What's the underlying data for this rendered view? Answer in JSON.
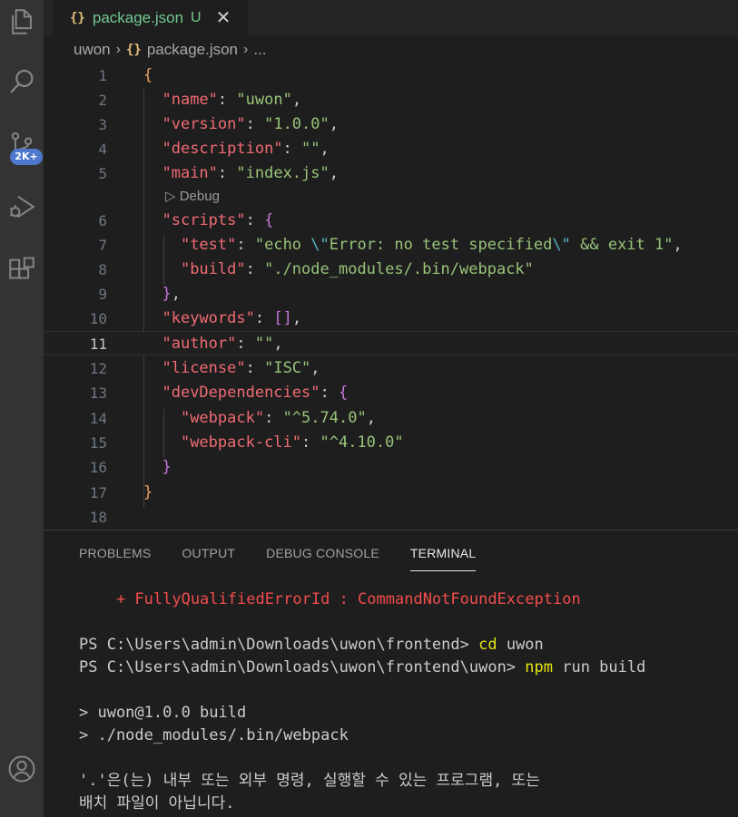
{
  "activity_bar": {
    "icons": [
      "explorer-icon",
      "search-icon",
      "source-control-icon",
      "run-debug-icon",
      "extensions-icon",
      "account-icon"
    ],
    "badge": "2K+"
  },
  "tab": {
    "icon": "{}",
    "name": "package.json",
    "status": "U",
    "close": "✕"
  },
  "breadcrumb": {
    "folder": "uwon",
    "file_icon": "{}",
    "file": "package.json",
    "sep": "›",
    "more": "..."
  },
  "editor": {
    "codelens": "Debug",
    "codelens_icon": "▷",
    "active_line": 11,
    "lines": [
      {
        "n": "1"
      },
      {
        "n": "2"
      },
      {
        "n": "3"
      },
      {
        "n": "4"
      },
      {
        "n": "5"
      },
      {
        "n": "6"
      },
      {
        "n": "7"
      },
      {
        "n": "8"
      },
      {
        "n": "9"
      },
      {
        "n": "10"
      },
      {
        "n": "11"
      },
      {
        "n": "12"
      },
      {
        "n": "13"
      },
      {
        "n": "14"
      },
      {
        "n": "15"
      },
      {
        "n": "16"
      },
      {
        "n": "17"
      },
      {
        "n": "18"
      }
    ]
  },
  "panel": {
    "tabs": [
      "PROBLEMS",
      "OUTPUT",
      "DEBUG CONSOLE",
      "TERMINAL"
    ],
    "active_tab": "TERMINAL",
    "terminal": {
      "error_line": "    + FullyQualifiedErrorId : CommandNotFoundException",
      "prompt1": "PS C:\\Users\\admin\\Downloads\\uwon\\frontend> ",
      "cmd1": "cd",
      "arg1": " uwon",
      "prompt2": "PS C:\\Users\\admin\\Downloads\\uwon\\frontend\\uwon> ",
      "cmd2": "npm",
      "arg2": " run build",
      "out1": "> uwon@1.0.0 build",
      "out2": "> ./node_modules/.bin/webpack",
      "msg1": "'.'은(는) 내부 또는 외부 명령, 실행할 수 있는 프로그램, 또는",
      "msg2": "배치 파일이 아닙니다."
    }
  },
  "colors": {
    "key": "#ef6b73",
    "string": "#98c379",
    "brace": "#e5a260",
    "bracket2": "#c678dd",
    "terminal_error": "#f14c4c",
    "terminal_cmd": "#e5e510",
    "badge": "#4d78cc"
  }
}
